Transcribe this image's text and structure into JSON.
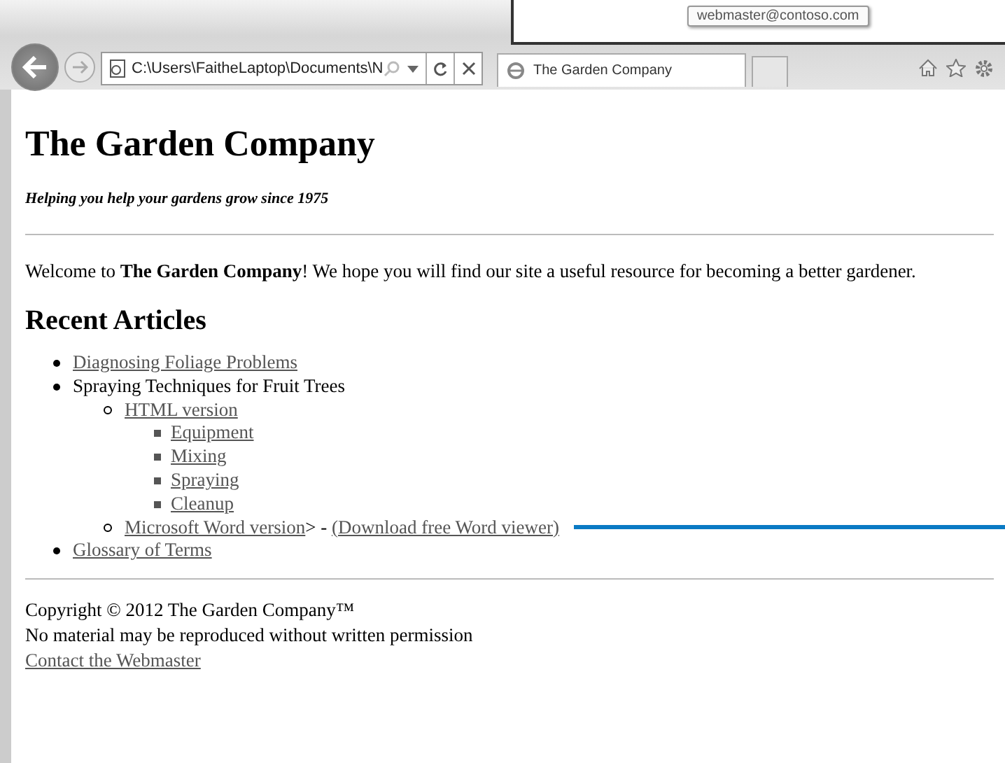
{
  "popup": {
    "tooltip": "webmaster@contoso.com"
  },
  "browser": {
    "address": "C:\\Users\\FaitheLaptop\\Documents\\N",
    "tabs": [
      {
        "title": "The Garden Company",
        "selected": true
      }
    ]
  },
  "page": {
    "title": "The Garden Company",
    "tagline": "Helping you help your gardens grow since 1975",
    "welcome": "Welcome to **The Garden Company**! We hope you will find our site a useful resource for becoming a better gardener.",
    "heading": "Recent Articles",
    "articles": [
      {
        "parts": [
          {
            "kind": "link",
            "text": "Diagnosing Foliage Problems"
          }
        ]
      },
      {
        "parts": [
          {
            "kind": "text",
            "text": "Spraying Techniques for Fruit Trees"
          }
        ],
        "children": [
          {
            "parts": [
              {
                "kind": "link",
                "text": "HTML version"
              }
            ],
            "children": [
              {
                "parts": [
                  {
                    "kind": "link",
                    "text": "Equipment"
                  }
                ]
              },
              {
                "parts": [
                  {
                    "kind": "link",
                    "text": "Mixing"
                  }
                ]
              },
              {
                "parts": [
                  {
                    "kind": "link",
                    "text": "Spraying"
                  }
                ]
              },
              {
                "parts": [
                  {
                    "kind": "link",
                    "text": "Cleanup"
                  }
                ]
              }
            ]
          },
          {
            "parts": [
              {
                "kind": "link",
                "text": "Microsoft Word version"
              },
              {
                "kind": "text",
                "text": "> - "
              },
              {
                "kind": "link",
                "text": "(Download free Word viewer)"
              }
            ],
            "callout": true
          }
        ]
      },
      {
        "parts": [
          {
            "kind": "link",
            "text": "Glossary of Terms"
          }
        ]
      }
    ],
    "footer": {
      "copyright": "Copyright © 2012 The Garden Company™",
      "notice": "No material may be reproduced without written permission",
      "contact": "Contact the Webmaster"
    }
  }
}
